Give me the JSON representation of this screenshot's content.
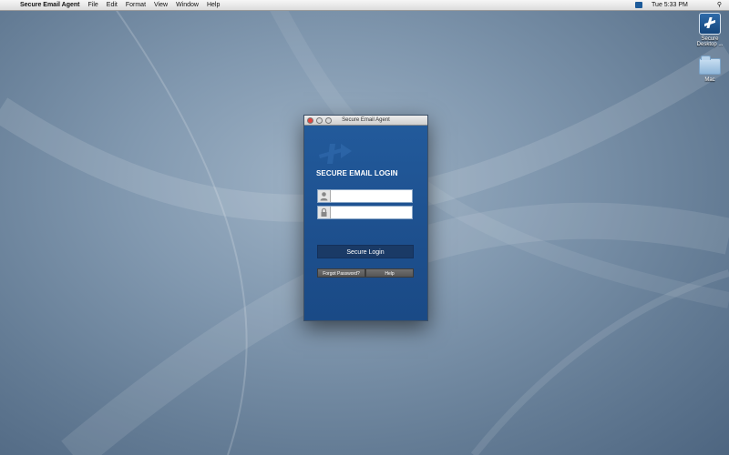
{
  "menubar": {
    "app_name": "Secure Email Agent",
    "menus": [
      "File",
      "Edit",
      "Format",
      "View",
      "Window",
      "Help"
    ],
    "clock": "Tue 5:33 PM"
  },
  "desktop": {
    "icons": [
      {
        "label": "Secure Desktop ...",
        "icon": "app-icon"
      },
      {
        "label": "Mac",
        "icon": "folder-icon"
      }
    ]
  },
  "window": {
    "title": "Secure Email Agent",
    "heading": "SECURE EMAIL LOGIN",
    "username": {
      "value": "",
      "placeholder": ""
    },
    "password": {
      "value": "",
      "placeholder": ""
    },
    "login_label": "Secure Login",
    "forgot_label": "Forgot Password?",
    "help_label": "Help"
  },
  "colors": {
    "window_blue": "#1d4f8d",
    "login_button": "#1a3a66",
    "close_light": "#e0443e"
  }
}
